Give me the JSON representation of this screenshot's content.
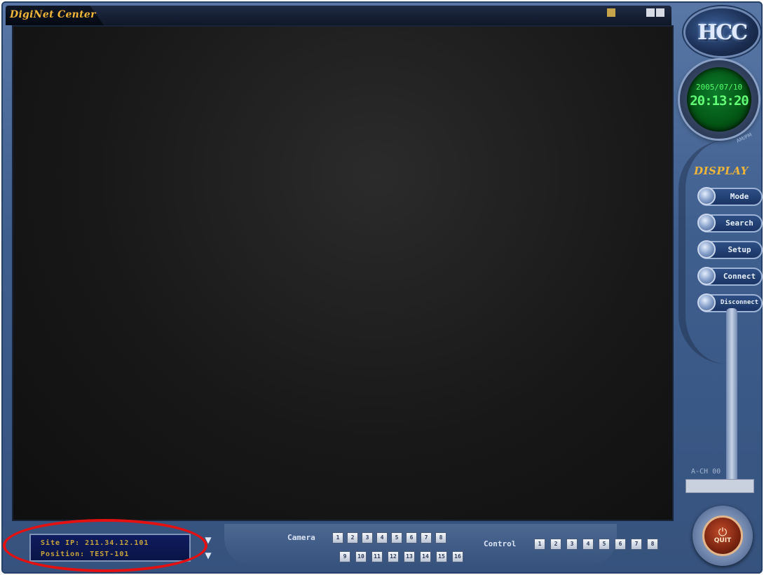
{
  "window": {
    "title": "DigiNet Center",
    "tb_icon_1": "tray-icon",
    "tb_icon_2": "minimize-icon",
    "tb_icon_3": "close-icon"
  },
  "logo": {
    "text": "HCC"
  },
  "clock": {
    "date": "2005/07/10",
    "time": "20:13:20",
    "caption": "AM/PM"
  },
  "display": {
    "heading": "DISPLAY",
    "buttons": [
      {
        "label": "Mode"
      },
      {
        "label": "Search"
      },
      {
        "label": "Setup"
      },
      {
        "label": "Connect"
      },
      {
        "label": "Disconnect"
      }
    ]
  },
  "audio": {
    "label": "A-CH 00"
  },
  "quit": {
    "label": "QUIT"
  },
  "site": {
    "ip_line": "Site IP: 211.34.12.101",
    "position_line": "Position: TEST-101"
  },
  "camera": {
    "label": "Camera",
    "row1": [
      "1",
      "2",
      "3",
      "4",
      "5",
      "6",
      "7",
      "8"
    ],
    "row2": [
      "9",
      "10",
      "11",
      "12",
      "13",
      "14",
      "15",
      "16"
    ]
  },
  "control": {
    "label": "Control",
    "buttons": [
      "1",
      "2",
      "3",
      "4",
      "5",
      "6",
      "7",
      "8"
    ]
  },
  "colors": {
    "accent": "#f0b63a",
    "frame": "#3f5f8f",
    "highlight": "#e31111"
  }
}
